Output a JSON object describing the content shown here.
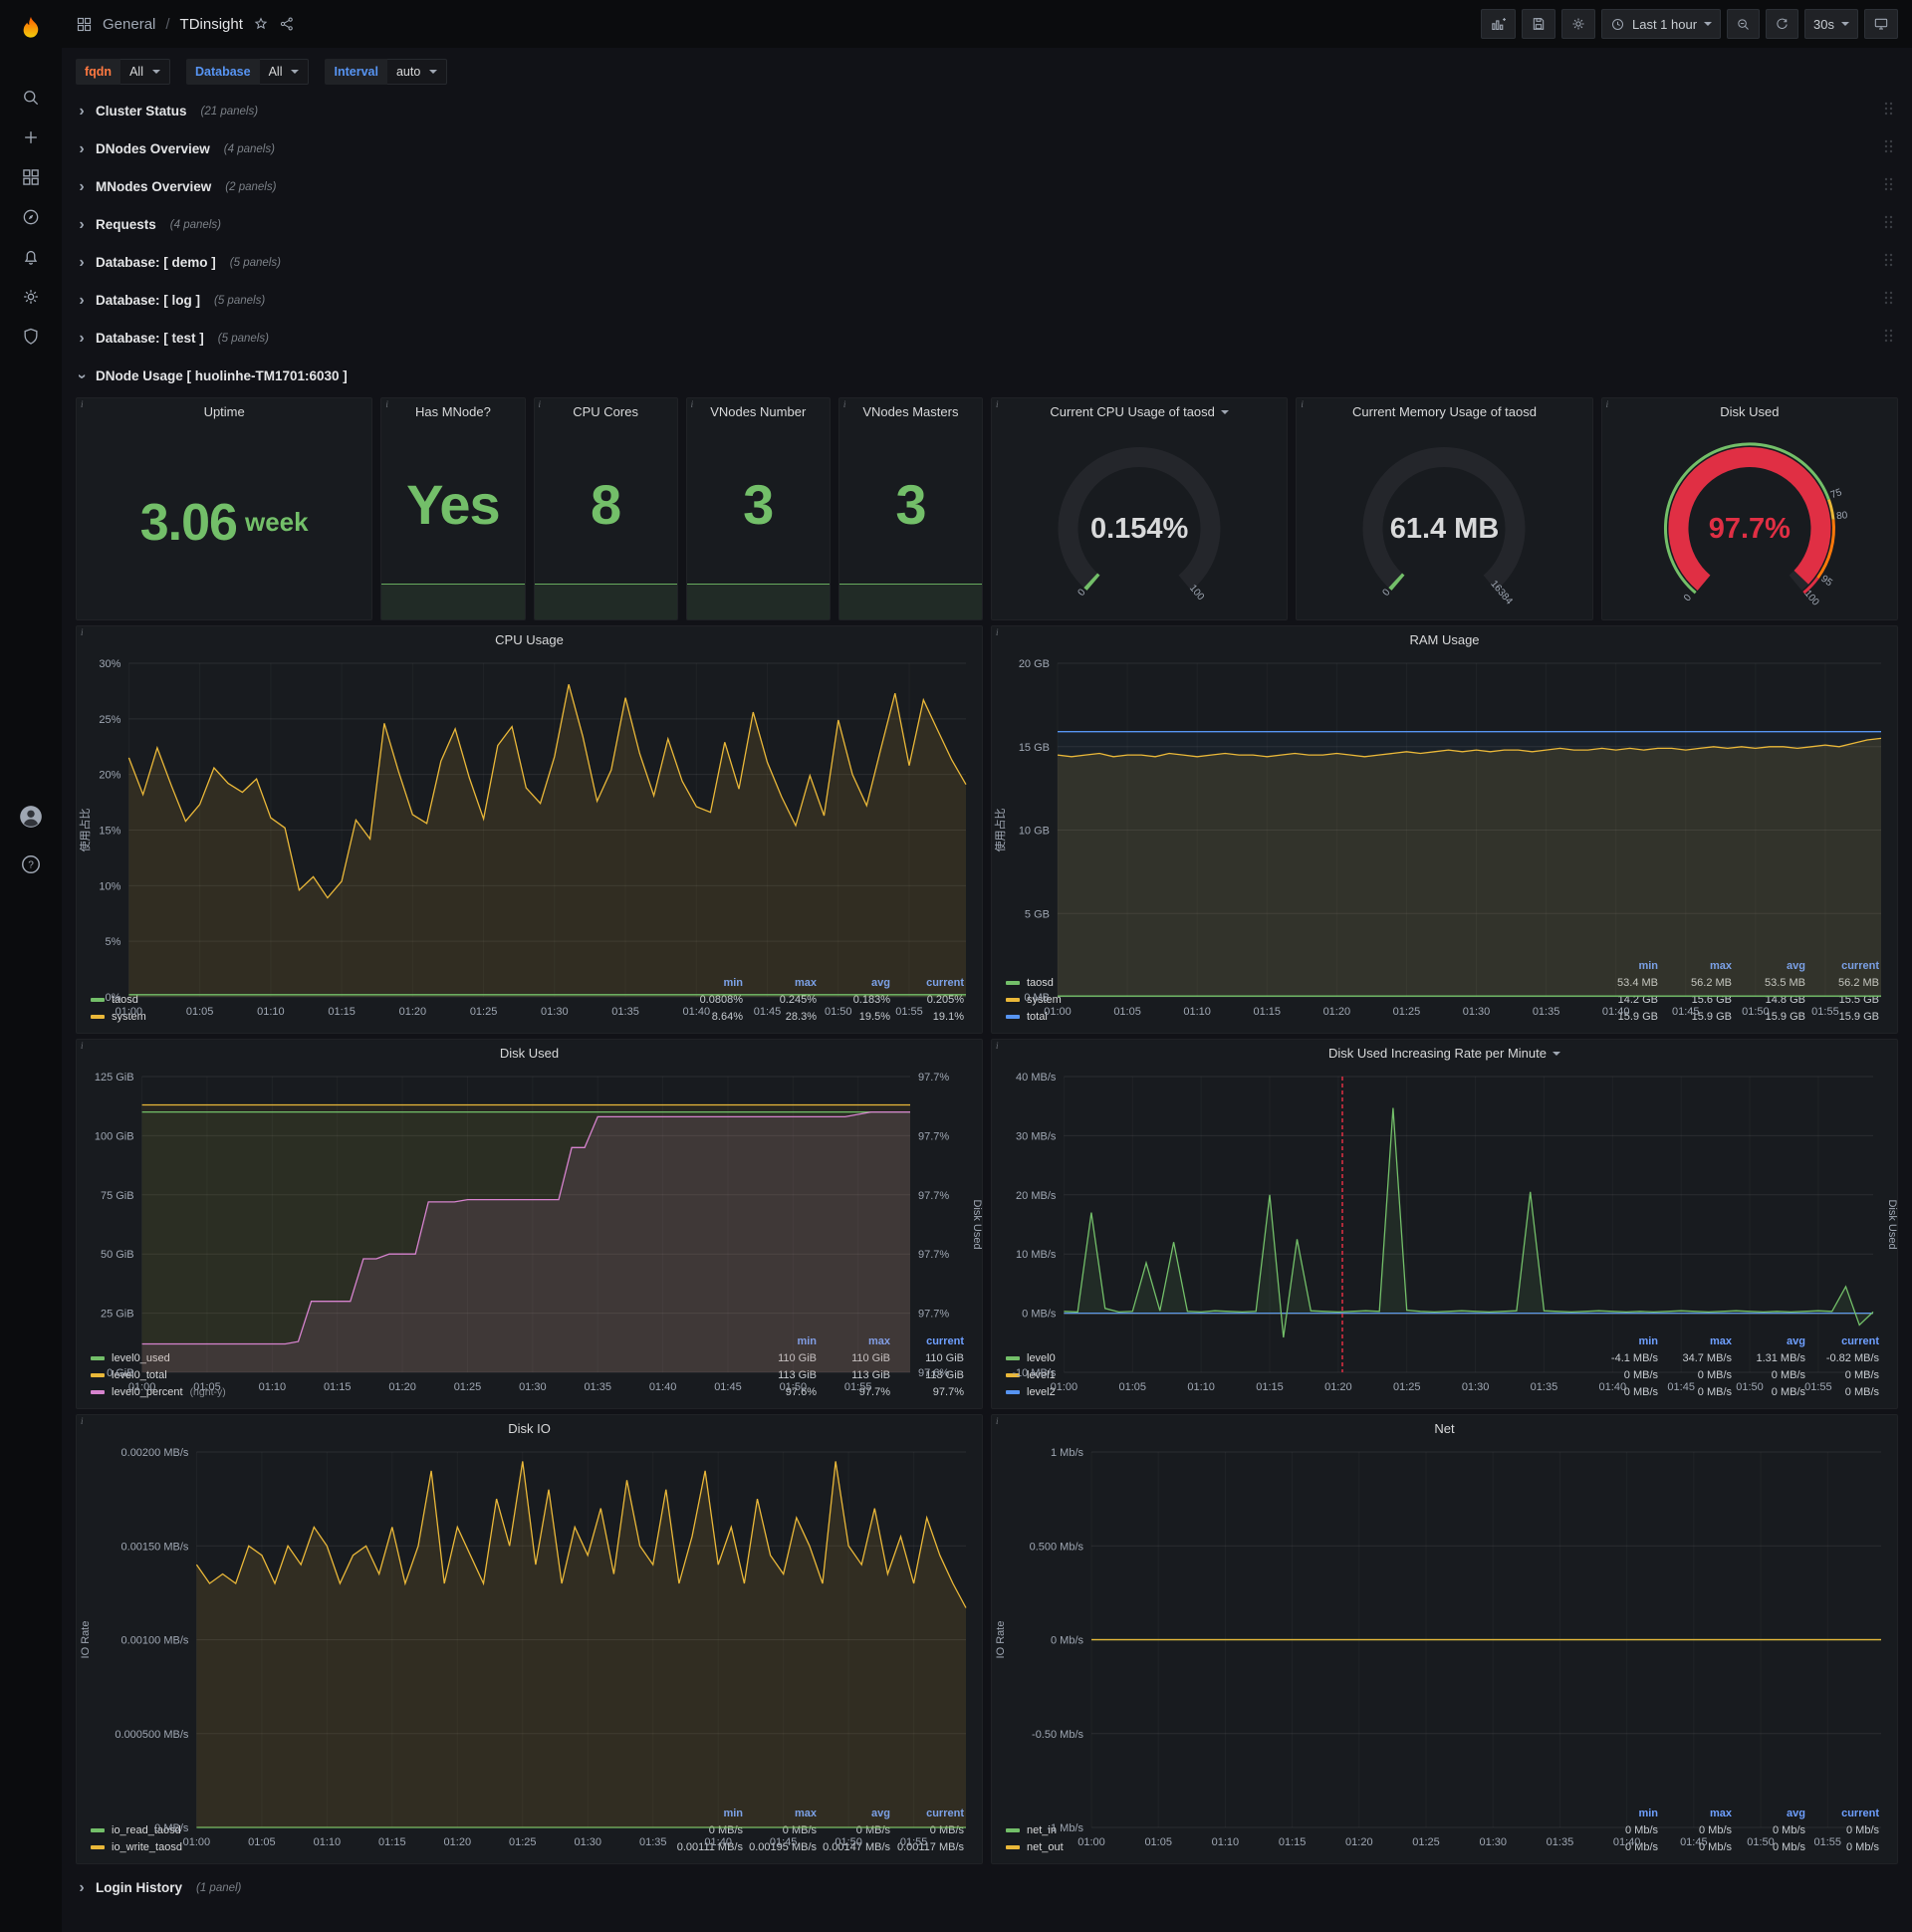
{
  "icons": {
    "chevron": "›",
    "info": "i",
    "help": "?"
  },
  "colors": {
    "green": "#73bf69",
    "yellow": "#eab839",
    "blue": "#5794f2",
    "pink": "#d683ce",
    "red": "#e02f44"
  },
  "nav": {
    "section": "General",
    "sep": "/",
    "title": "TDinsight",
    "time_range": "Last 1 hour",
    "refresh": "30s"
  },
  "variables": [
    {
      "label": "fqdn",
      "value": "All",
      "color": "#ff7941"
    },
    {
      "label": "Database",
      "value": "All",
      "color": "#5794f2"
    },
    {
      "label": "Interval",
      "value": "auto",
      "color": "#5794f2"
    }
  ],
  "rows_top": [
    {
      "title": "Cluster Status",
      "count": "(21 panels)"
    },
    {
      "title": "DNodes Overview",
      "count": "(4 panels)"
    },
    {
      "title": "MNodes Overview",
      "count": "(2 panels)"
    },
    {
      "title": "Requests",
      "count": "(4 panels)"
    },
    {
      "title": "Database: [ demo ]",
      "count": "(5 panels)"
    },
    {
      "title": "Database: [ log ]",
      "count": "(5 panels)"
    },
    {
      "title": "Database: [ test ]",
      "count": "(5 panels)"
    }
  ],
  "dnode_row": {
    "title": "DNode Usage [ huolinhe-TM1701:6030 ]"
  },
  "login_row": {
    "title": "Login History",
    "count": "(1 panel)"
  },
  "stats": [
    {
      "title": "Uptime",
      "value": "3.06",
      "unit": "week"
    },
    {
      "title": "Has MNode?",
      "value": "Yes",
      "unit": ""
    },
    {
      "title": "CPU Cores",
      "value": "8",
      "unit": ""
    },
    {
      "title": "VNodes Number",
      "value": "3",
      "unit": ""
    },
    {
      "title": "VNodes Masters",
      "value": "3",
      "unit": ""
    }
  ],
  "gauges": [
    {
      "title": "Current CPU Usage of taosd",
      "caret": true,
      "value": "0.154%",
      "min": "0",
      "max": "100",
      "fraction": 0.0015,
      "color": "#73bf69",
      "value_color": "#d8d9da"
    },
    {
      "title": "Current Memory Usage of taosd",
      "caret": false,
      "value": "61.4 MB",
      "min": "0",
      "max": "16384",
      "fraction": 0.004,
      "color": "#73bf69",
      "value_color": "#d8d9da"
    },
    {
      "title": "Disk Used",
      "caret": false,
      "value": "97.7%",
      "min": "0",
      "max": "",
      "fraction": 0.977,
      "color": "#e02f44",
      "value_color": "#e02f44",
      "ring": [
        {
          "from": 0,
          "to": 0.75,
          "color": "#73bf69"
        },
        {
          "from": 0.75,
          "to": 0.8,
          "color": "#eab839"
        },
        {
          "from": 0.8,
          "to": 0.95,
          "color": "#ff780a"
        },
        {
          "from": 0.95,
          "to": 1,
          "color": "#e02f44"
        }
      ],
      "thresh_labels": [
        {
          "value": 75,
          "label": "75"
        },
        {
          "value": 80,
          "label": "80"
        },
        {
          "value": 95,
          "label": "95"
        },
        {
          "value": 100,
          "label": "100"
        }
      ]
    }
  ],
  "charts": {
    "cpu": {
      "type": "line",
      "title": "CPU Usage",
      "caret": false,
      "left_label": "使用占比",
      "ymin": 0,
      "ymax": 30,
      "yticks": [
        "0%",
        "5%",
        "10%",
        "15%",
        "20%",
        "25%",
        "30%"
      ],
      "xticks": [
        "01:00",
        "01:05",
        "01:10",
        "01:15",
        "01:20",
        "01:25",
        "01:30",
        "01:35",
        "01:40",
        "01:45",
        "01:50",
        "01:55"
      ],
      "series": [
        {
          "name": "system",
          "color": "#eab839",
          "fill": 0.12,
          "values": [
            21.5,
            18.2,
            22.4,
            19,
            15.8,
            17.3,
            20.6,
            19.2,
            18.4,
            19.6,
            16.1,
            15.2,
            9.6,
            10.8,
            8.9,
            10.4,
            15.9,
            14.2,
            24.6,
            20.3,
            16.4,
            15.6,
            21.2,
            24.1,
            19.7,
            16,
            22.6,
            24.3,
            18.8,
            17.4,
            21.6,
            28.1,
            23.4,
            17.6,
            20.4,
            26.9,
            21.9,
            18.1,
            23.2,
            19.4,
            17.1,
            16.6,
            22.9,
            18.7,
            25.6,
            21.1,
            18,
            15.4,
            19.9,
            16.3,
            24.9,
            20,
            17.2,
            22.3,
            27.3,
            20.8,
            26.7,
            24,
            21.3,
            19.1
          ]
        },
        {
          "name": "taosd",
          "color": "#73bf69",
          "fill": 0.1,
          "const": 0.2,
          "n": 60
        }
      ],
      "legend": {
        "cols": [
          "min",
          "max",
          "avg",
          "current"
        ],
        "rows": [
          {
            "name": "taosd",
            "color": "#73bf69",
            "vals": [
              "0.0808%",
              "0.245%",
              "0.183%",
              "0.205%"
            ]
          },
          {
            "name": "system",
            "color": "#eab839",
            "vals": [
              "8.64%",
              "28.3%",
              "19.5%",
              "19.1%"
            ]
          }
        ]
      }
    },
    "ram": {
      "type": "line",
      "title": "RAM Usage",
      "caret": false,
      "left_label": "使用占比",
      "ymin": 0,
      "ymax": 20,
      "yticks": [
        "0 MB",
        "5 GB",
        "10 GB",
        "15 GB",
        "20 GB"
      ],
      "xticks": [
        "01:00",
        "01:05",
        "01:10",
        "01:15",
        "01:20",
        "01:25",
        "01:30",
        "01:35",
        "01:40",
        "01:45",
        "01:50",
        "01:55"
      ],
      "series": [
        {
          "name": "total",
          "color": "#5794f2",
          "fill": 0.05,
          "const": 15.9,
          "n": 60
        },
        {
          "name": "system",
          "color": "#eab839",
          "fill": 0.12,
          "values": [
            14.5,
            14.4,
            14.5,
            14.6,
            14.4,
            14.5,
            14.5,
            14.4,
            14.6,
            14.5,
            14.4,
            14.5,
            14.6,
            14.5,
            14.5,
            14.4,
            14.5,
            14.6,
            14.5,
            14.5,
            14.6,
            14.5,
            14.4,
            14.5,
            14.6,
            14.7,
            14.6,
            14.7,
            14.8,
            14.7,
            14.8,
            14.7,
            14.8,
            14.8,
            14.7,
            14.8,
            14.9,
            14.8,
            14.8,
            14.9,
            14.8,
            14.9,
            14.8,
            14.9,
            14.9,
            14.8,
            14.9,
            15,
            14.9,
            15,
            14.9,
            15,
            15,
            14.9,
            15,
            15.1,
            15,
            15.2,
            15.4,
            15.5
          ]
        },
        {
          "name": "taosd",
          "color": "#73bf69",
          "fill": 0.1,
          "const": 0.05,
          "n": 60
        }
      ],
      "legend": {
        "cols": [
          "min",
          "max",
          "avg",
          "current"
        ],
        "rows": [
          {
            "name": "taosd",
            "color": "#73bf69",
            "vals": [
              "53.4 MB",
              "56.2 MB",
              "53.5 MB",
              "56.2 MB"
            ]
          },
          {
            "name": "system",
            "color": "#eab839",
            "vals": [
              "14.2 GB",
              "15.6 GB",
              "14.8 GB",
              "15.5 GB"
            ]
          },
          {
            "name": "total",
            "color": "#5794f2",
            "vals": [
              "15.9 GB",
              "15.9 GB",
              "15.9 GB",
              "15.9 GB"
            ]
          }
        ]
      }
    },
    "disk": {
      "type": "line",
      "title": "Disk Used",
      "caret": false,
      "ymin": 0,
      "ymax": 125,
      "yticks": [
        "0 GiB",
        "25 GiB",
        "50 GiB",
        "75 GiB",
        "100 GiB",
        "125 GiB"
      ],
      "right_ticks": [
        "97.6%",
        "97.7%",
        "97.7%",
        "97.7%",
        "97.7%",
        "97.7%"
      ],
      "right_label": "Disk Used",
      "xticks": [
        "01:00",
        "01:05",
        "01:10",
        "01:15",
        "01:20",
        "01:25",
        "01:30",
        "01:35",
        "01:40",
        "01:45",
        "01:50",
        "01:55"
      ],
      "series": [
        {
          "name": "level0_total",
          "color": "#eab839",
          "fill": 0.08,
          "const": 113,
          "n": 60
        },
        {
          "name": "level0_used",
          "color": "#73bf69",
          "fill": 0.05,
          "const": 110,
          "n": 60
        },
        {
          "name": "level0_percent",
          "color": "#d683ce",
          "fill": 0.12,
          "values": [
            12,
            12,
            12,
            12,
            12,
            12,
            12,
            12,
            12,
            12,
            12,
            12,
            13,
            30,
            30,
            30,
            30,
            48,
            48,
            50,
            50,
            50,
            72,
            72,
            72,
            73,
            73,
            73,
            73,
            73,
            73,
            73,
            73,
            95,
            95,
            108,
            108,
            108,
            108,
            108,
            108,
            108,
            108,
            108,
            108,
            108,
            108,
            108,
            108,
            108,
            108,
            108,
            108,
            108,
            108,
            109,
            110,
            110,
            110,
            110
          ]
        }
      ],
      "legend": {
        "cols": [
          "min",
          "max",
          "current"
        ],
        "rows": [
          {
            "name": "level0_used",
            "color": "#73bf69",
            "vals": [
              "110 GiB",
              "110 GiB",
              "110 GiB"
            ]
          },
          {
            "name": "level0_total",
            "color": "#eab839",
            "vals": [
              "113 GiB",
              "113 GiB",
              "113 GiB"
            ]
          },
          {
            "name": "level0_percent",
            "suffix": "(right-y)",
            "color": "#d683ce",
            "vals": [
              "97.6%",
              "97.7%",
              "97.7%"
            ]
          }
        ]
      }
    },
    "diskrate": {
      "type": "line",
      "title": "Disk Used Increasing Rate per Minute",
      "caret": true,
      "ymin": -10,
      "ymax": 40,
      "yticks": [
        "-10 MB/s",
        "0 MB/s",
        "10 MB/s",
        "20 MB/s",
        "30 MB/s",
        "40 MB/s"
      ],
      "right_label": "Disk Used",
      "annotation_min": 20.3,
      "xticks": [
        "01:00",
        "01:05",
        "01:10",
        "01:15",
        "01:20",
        "01:25",
        "01:30",
        "01:35",
        "01:40",
        "01:45",
        "01:50",
        "01:55"
      ],
      "series": [
        {
          "name": "level1",
          "color": "#eab839",
          "const": 0,
          "n": 60
        },
        {
          "name": "level2",
          "color": "#5794f2",
          "const": 0,
          "n": 60
        },
        {
          "name": "level0",
          "color": "#73bf69",
          "fill": 0.1,
          "values": [
            0.3,
            0.2,
            17,
            0.8,
            0.2,
            0.3,
            8.5,
            0.4,
            12,
            0.3,
            0.2,
            0.4,
            0.3,
            0.2,
            0.3,
            20,
            -4.1,
            12.5,
            0.4,
            0.3,
            0.2,
            0.3,
            0.4,
            0.3,
            34.7,
            0.5,
            0.3,
            0.2,
            0.3,
            0.4,
            0.3,
            0.2,
            0.3,
            0.4,
            20.5,
            0.4,
            0.3,
            0.2,
            0.3,
            0.4,
            0.3,
            0.2,
            0.3,
            0.2,
            0.3,
            0.4,
            0.3,
            0.2,
            0.3,
            0.4,
            0.3,
            0.2,
            0.3,
            0.2,
            0.3,
            0.4,
            0.3,
            4.5,
            -2,
            0.2
          ]
        }
      ],
      "legend": {
        "cols": [
          "min",
          "max",
          "avg",
          "current"
        ],
        "rows": [
          {
            "name": "level0",
            "color": "#73bf69",
            "vals": [
              "-4.1 MB/s",
              "34.7 MB/s",
              "1.31 MB/s",
              "-0.82 MB/s"
            ]
          },
          {
            "name": "level1",
            "color": "#eab839",
            "vals": [
              "0 MB/s",
              "0 MB/s",
              "0 MB/s",
              "0 MB/s"
            ]
          },
          {
            "name": "level2",
            "color": "#5794f2",
            "vals": [
              "0 MB/s",
              "0 MB/s",
              "0 MB/s",
              "0 MB/s"
            ]
          }
        ]
      }
    },
    "diskio": {
      "type": "line",
      "title": "Disk IO",
      "caret": false,
      "left_label": "IO Rate",
      "ymin": 0,
      "ymax": 0.002,
      "yticks": [
        "0 MB/s",
        "0.000500 MB/s",
        "0.00100 MB/s",
        "0.00150 MB/s",
        "0.00200 MB/s"
      ],
      "xticks": [
        "01:00",
        "01:05",
        "01:10",
        "01:15",
        "01:20",
        "01:25",
        "01:30",
        "01:35",
        "01:40",
        "01:45",
        "01:50",
        "01:55"
      ],
      "series": [
        {
          "name": "io_read_taosd",
          "color": "#73bf69",
          "fill": 0.1,
          "const": 0,
          "n": 60
        },
        {
          "name": "io_write_taosd",
          "color": "#eab839",
          "fill": 0.12,
          "values": [
            0.0014,
            0.0013,
            0.00135,
            0.0013,
            0.0015,
            0.00145,
            0.0013,
            0.0015,
            0.0014,
            0.0016,
            0.0015,
            0.0013,
            0.00145,
            0.0015,
            0.00135,
            0.0016,
            0.0013,
            0.0015,
            0.0019,
            0.0013,
            0.0016,
            0.00145,
            0.0013,
            0.00175,
            0.0015,
            0.00195,
            0.0014,
            0.0018,
            0.0013,
            0.0016,
            0.00145,
            0.0017,
            0.00135,
            0.00185,
            0.0015,
            0.0014,
            0.0018,
            0.0013,
            0.00155,
            0.0019,
            0.0014,
            0.0016,
            0.0013,
            0.00175,
            0.00145,
            0.00135,
            0.00165,
            0.0015,
            0.0013,
            0.00195,
            0.0015,
            0.0014,
            0.0017,
            0.00135,
            0.00155,
            0.0013,
            0.00165,
            0.00145,
            0.0013,
            0.00117
          ]
        }
      ],
      "legend": {
        "cols": [
          "min",
          "max",
          "avg",
          "current"
        ],
        "rows": [
          {
            "name": "io_read_taosd",
            "color": "#73bf69",
            "vals": [
              "0 MB/s",
              "0 MB/s",
              "0 MB/s",
              "0 MB/s"
            ]
          },
          {
            "name": "io_write_taosd",
            "color": "#eab839",
            "vals": [
              "0.00111 MB/s",
              "0.00195 MB/s",
              "0.00147 MB/s",
              "0.00117 MB/s"
            ]
          }
        ]
      }
    },
    "net": {
      "type": "line",
      "title": "Net",
      "caret": false,
      "left_label": "IO Rate",
      "ymin": -1,
      "ymax": 1,
      "yticks": [
        "-1 Mb/s",
        "-0.50 Mb/s",
        "0 Mb/s",
        "0.500 Mb/s",
        "1 Mb/s"
      ],
      "xticks": [
        "01:00",
        "01:05",
        "01:10",
        "01:15",
        "01:20",
        "01:25",
        "01:30",
        "01:35",
        "01:40",
        "01:45",
        "01:50",
        "01:55"
      ],
      "series": [
        {
          "name": "net_in",
          "color": "#73bf69",
          "const": 0,
          "n": 60
        },
        {
          "name": "net_out",
          "color": "#eab839",
          "const": 0,
          "n": 60
        }
      ],
      "legend": {
        "cols": [
          "min",
          "max",
          "avg",
          "current"
        ],
        "rows": [
          {
            "name": "net_in",
            "color": "#73bf69",
            "vals": [
              "0 Mb/s",
              "0 Mb/s",
              "0 Mb/s",
              "0 Mb/s"
            ]
          },
          {
            "name": "net_out",
            "color": "#eab839",
            "vals": [
              "0 Mb/s",
              "0 Mb/s",
              "0 Mb/s",
              "0 Mb/s"
            ]
          }
        ]
      }
    }
  }
}
